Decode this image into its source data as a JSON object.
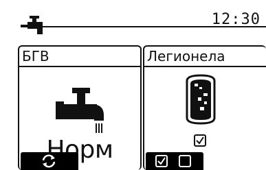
{
  "status": {
    "time": "12:30",
    "icons": [
      "tap-icon"
    ]
  },
  "panels": {
    "dhw": {
      "title": "БГВ",
      "mode": "Норм",
      "icon": "tap-water-icon"
    },
    "legionella": {
      "title": "Легионела",
      "icon": "tank-icon",
      "enabled": true
    }
  },
  "softkeys": {
    "left": {
      "icon": "rotate-arrows-icon"
    },
    "right": {
      "icons": [
        "checkbox-checked-icon",
        "checkbox-empty-icon"
      ]
    }
  }
}
